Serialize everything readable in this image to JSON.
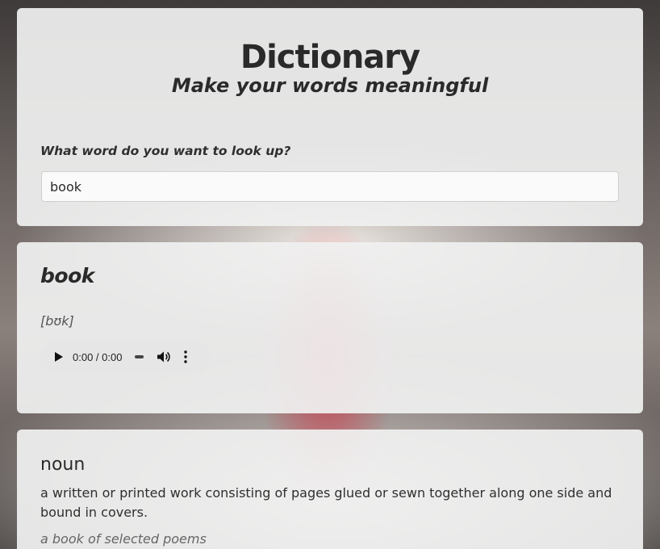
{
  "header": {
    "title": "Dictionary",
    "subtitle": "Make your words meaningful"
  },
  "search": {
    "label": "What word do you want to look up?",
    "value": "book"
  },
  "result": {
    "word": "book",
    "phonetic": "[bʊk]",
    "audio": {
      "time": "0:00 / 0:00"
    }
  },
  "meanings": [
    {
      "part_of_speech": "noun",
      "definition": "a written or printed work consisting of pages glued or sewn together along one side and bound in covers.",
      "example": "a book of selected poems"
    }
  ]
}
